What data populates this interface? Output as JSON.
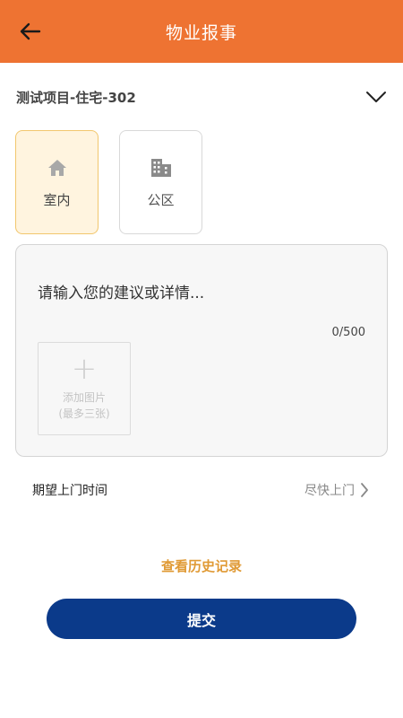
{
  "header": {
    "title": "物业报事",
    "back_icon": "arrow-left-icon"
  },
  "project": {
    "name": "测试项目-住宅-302",
    "dropdown_icon": "chevron-down-icon"
  },
  "report_types": [
    {
      "label": "室内",
      "icon": "home-icon",
      "selected": true
    },
    {
      "label": "公区",
      "icon": "building-icon",
      "selected": false
    }
  ],
  "detail": {
    "placeholder": "请输入您的建议或详情...",
    "value": "",
    "char_count": "0/500",
    "add_photo": {
      "line1": "添加图片",
      "line2": "(最多三张)"
    }
  },
  "visit_time": {
    "label": "期望上门时间",
    "value": "尽快上门"
  },
  "history_link": "查看历史记录",
  "submit_label": "提交",
  "colors": {
    "header_bg": "#EE7332",
    "active_card_bg": "#FFF4DF",
    "active_card_border": "#F2C76E",
    "link": "#E09A35",
    "submit_bg": "#0B3A8A"
  }
}
